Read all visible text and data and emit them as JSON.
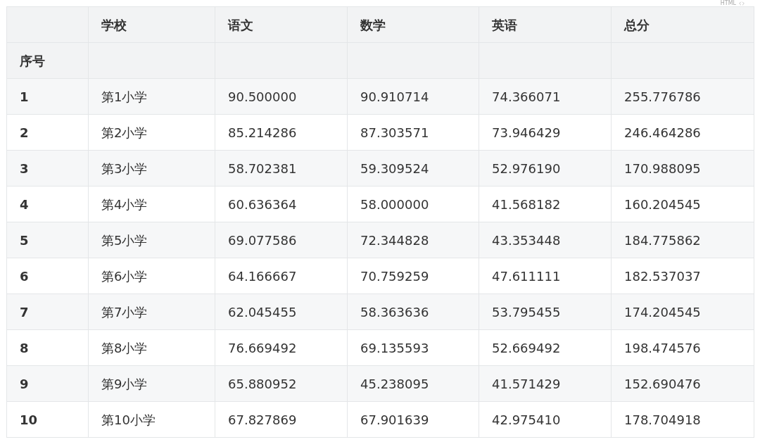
{
  "badge": {
    "label": "HTML"
  },
  "table": {
    "columns": [
      "学校",
      "语文",
      "数学",
      "英语",
      "总分"
    ],
    "index_name": "序号",
    "rows": [
      {
        "index": "1",
        "cells": [
          "第1小学",
          "90.500000",
          "90.910714",
          "74.366071",
          "255.776786"
        ]
      },
      {
        "index": "2",
        "cells": [
          "第2小学",
          "85.214286",
          "87.303571",
          "73.946429",
          "246.464286"
        ]
      },
      {
        "index": "3",
        "cells": [
          "第3小学",
          "58.702381",
          "59.309524",
          "52.976190",
          "170.988095"
        ]
      },
      {
        "index": "4",
        "cells": [
          "第4小学",
          "60.636364",
          "58.000000",
          "41.568182",
          "160.204545"
        ]
      },
      {
        "index": "5",
        "cells": [
          "第5小学",
          "69.077586",
          "72.344828",
          "43.353448",
          "184.775862"
        ]
      },
      {
        "index": "6",
        "cells": [
          "第6小学",
          "64.166667",
          "70.759259",
          "47.611111",
          "182.537037"
        ]
      },
      {
        "index": "7",
        "cells": [
          "第7小学",
          "62.045455",
          "58.363636",
          "53.795455",
          "174.204545"
        ]
      },
      {
        "index": "8",
        "cells": [
          "第8小学",
          "76.669492",
          "69.135593",
          "52.669492",
          "198.474576"
        ]
      },
      {
        "index": "9",
        "cells": [
          "第9小学",
          "65.880952",
          "45.238095",
          "41.571429",
          "152.690476"
        ]
      },
      {
        "index": "10",
        "cells": [
          "第10小学",
          "67.827869",
          "67.901639",
          "42.975410",
          "178.704918"
        ]
      }
    ]
  }
}
